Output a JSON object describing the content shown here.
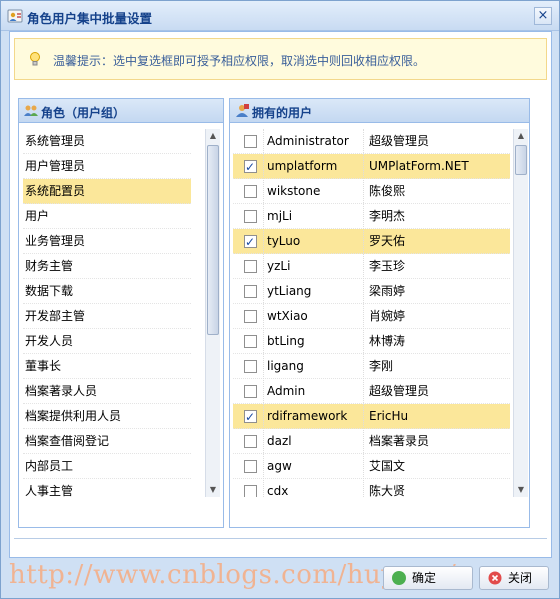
{
  "window": {
    "title": "角色用户集中批量设置",
    "close_glyph": "×"
  },
  "tip": {
    "text": "温馨提示：选中复选框即可授予相应权限，取消选中则回收相应权限。"
  },
  "roles_panel": {
    "title": "角色（用户组）",
    "items": [
      {
        "label": "系统管理员",
        "selected": false
      },
      {
        "label": "用户管理员",
        "selected": false
      },
      {
        "label": "系统配置员",
        "selected": true
      },
      {
        "label": "用户",
        "selected": false
      },
      {
        "label": "业务管理员",
        "selected": false
      },
      {
        "label": "财务主管",
        "selected": false
      },
      {
        "label": "数据下载",
        "selected": false
      },
      {
        "label": "开发部主管",
        "selected": false
      },
      {
        "label": "开发人员",
        "selected": false
      },
      {
        "label": "董事长",
        "selected": false
      },
      {
        "label": "档案著录人员",
        "selected": false
      },
      {
        "label": "档案提供利用人员",
        "selected": false
      },
      {
        "label": "档案查借阅登记",
        "selected": false
      },
      {
        "label": "内部员工",
        "selected": false
      },
      {
        "label": "人事主管",
        "selected": false
      }
    ]
  },
  "users_panel": {
    "title": "拥有的用户",
    "rows": [
      {
        "username": "Administrator",
        "realname": "超级管理员",
        "checked": false
      },
      {
        "username": "umplatform",
        "realname": "UMPlatForm.NET",
        "checked": true
      },
      {
        "username": "wikstone",
        "realname": "陈俊熙",
        "checked": false
      },
      {
        "username": "mjLi",
        "realname": "李明杰",
        "checked": false
      },
      {
        "username": "tyLuo",
        "realname": "罗天佑",
        "checked": true
      },
      {
        "username": "yzLi",
        "realname": "李玉珍",
        "checked": false
      },
      {
        "username": "ytLiang",
        "realname": "梁雨婷",
        "checked": false
      },
      {
        "username": "wtXiao",
        "realname": "肖婉婷",
        "checked": false
      },
      {
        "username": "btLing",
        "realname": "林博涛",
        "checked": false
      },
      {
        "username": "ligang",
        "realname": "李刚",
        "checked": false
      },
      {
        "username": "Admin",
        "realname": "超级管理员",
        "checked": false
      },
      {
        "username": "rdiframework",
        "realname": "EricHu",
        "checked": true
      },
      {
        "username": "dazl",
        "realname": "档案著录员",
        "checked": false
      },
      {
        "username": "agw",
        "realname": "艾国文",
        "checked": false
      },
      {
        "username": "cdx",
        "realname": "陈大贤",
        "checked": false
      }
    ]
  },
  "footer": {
    "watermark": "http://www.cnblogs.com/huyong/",
    "ok_label": "确定",
    "close_label": "关闭"
  },
  "colors": {
    "selected_row": "#fbe79a",
    "title_text": "#15428b",
    "watermark": "#f3b08a"
  }
}
